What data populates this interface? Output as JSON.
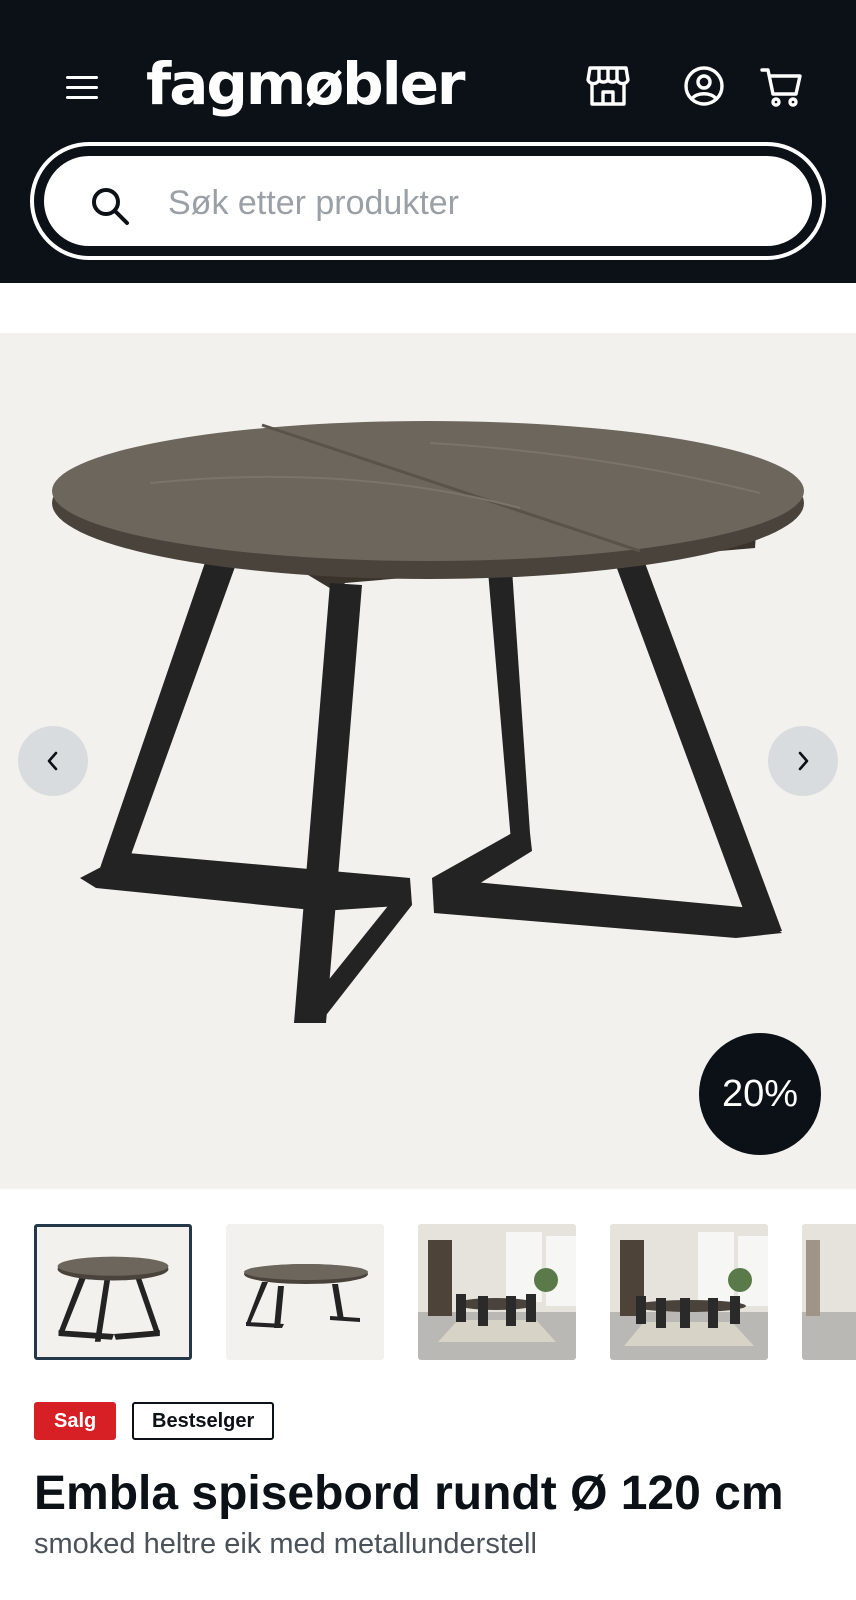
{
  "header": {
    "logo_text": "fagmøbler",
    "icons": [
      "menu-icon",
      "store-icon",
      "account-icon",
      "cart-icon"
    ]
  },
  "search": {
    "placeholder": "Søk etter produkter"
  },
  "gallery": {
    "discount_label": "20%",
    "thumbnail_count": 5,
    "active_thumbnail": 1
  },
  "product": {
    "badges": {
      "sale": "Salg",
      "bestseller": "Bestselger"
    },
    "title": "Embla spisebord rundt Ø 120 cm",
    "subtitle": "smoked heltre eik med metallunderstell"
  },
  "colors": {
    "header_bg": "#0b1116",
    "sale_badge": "#d71f26",
    "image_bg": "#f2f1ee"
  }
}
